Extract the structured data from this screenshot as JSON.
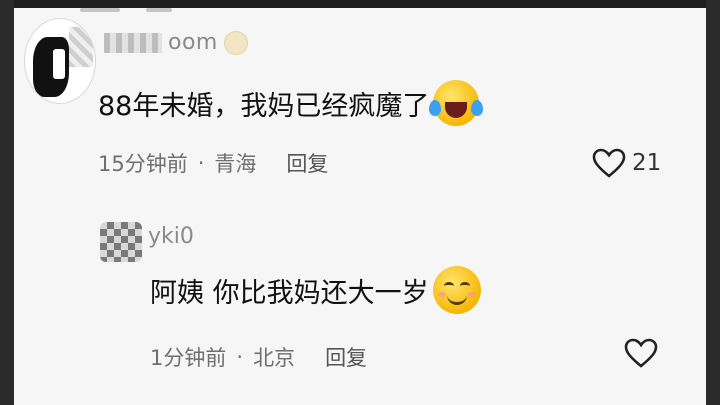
{
  "main_comment": {
    "username": "oom",
    "text": "88年未婚，我妈已经疯魔了",
    "emoji": "laughing-crying-emoji",
    "time": "15分钟前",
    "location": "青海",
    "reply_label": "回复",
    "like_count": "21"
  },
  "reply_comment": {
    "username": "yki0",
    "text": "阿姨 你比我妈还大一岁",
    "emoji": "smiling-emoji",
    "time": "1分钟前",
    "location": "北京",
    "reply_label": "回复"
  },
  "separator": "·",
  "colors": {
    "background": "#f6f6f6",
    "text": "#111111",
    "meta": "#6f6f6f",
    "emoji_yellow": "#f5b400"
  }
}
